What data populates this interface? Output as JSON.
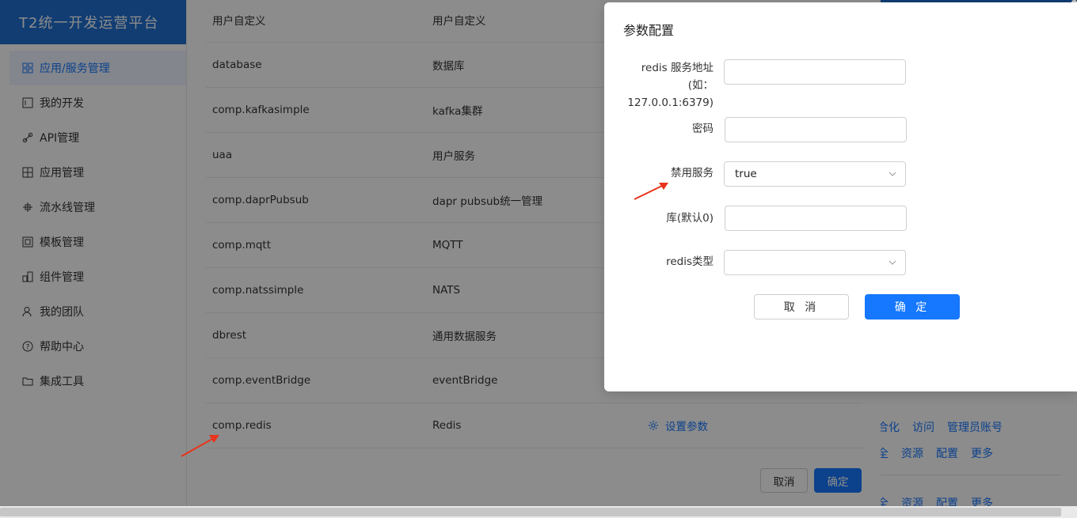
{
  "sidebar": {
    "brand": "T2统一开发运营平台",
    "items": [
      {
        "label": "应用/服务管理",
        "icon": "grid-icon"
      },
      {
        "label": "我的开发",
        "icon": "code-window-icon"
      },
      {
        "label": "API管理",
        "icon": "link-icon"
      },
      {
        "label": "应用管理",
        "icon": "apps-icon"
      },
      {
        "label": "流水线管理",
        "icon": "pipeline-icon"
      },
      {
        "label": "模板管理",
        "icon": "template-icon"
      },
      {
        "label": "组件管理",
        "icon": "component-icon"
      },
      {
        "label": "我的团队",
        "icon": "team-icon"
      },
      {
        "label": "帮助中心",
        "icon": "help-icon"
      },
      {
        "label": "集成工具",
        "icon": "folder-icon"
      }
    ]
  },
  "drawer": {
    "rows": [
      {
        "name": "用户自定义",
        "desc": "用户自定义"
      },
      {
        "name": "database",
        "desc": "数据库"
      },
      {
        "name": "comp.kafkasimple",
        "desc": "kafka集群"
      },
      {
        "name": "uaa",
        "desc": "用户服务"
      },
      {
        "name": "comp.daprPubsub",
        "desc": "dapr pubsub统一管理"
      },
      {
        "name": "comp.mqtt",
        "desc": "MQTT"
      },
      {
        "name": "comp.natssimple",
        "desc": "NATS"
      },
      {
        "name": "dbrest",
        "desc": "通用数据服务"
      },
      {
        "name": "comp.eventBridge",
        "desc": "eventBridge"
      },
      {
        "name": "comp.redis",
        "desc": "Redis",
        "action": "设置参数"
      }
    ],
    "cancel_label": "取消",
    "ok_label": "确定"
  },
  "background": {
    "row1_links": [
      "合化",
      "访问",
      "管理员账号"
    ],
    "row2_links": [
      "全",
      "资源",
      "配置",
      "更多"
    ],
    "row3_links": [
      "全",
      "资源",
      "配置",
      "更多"
    ]
  },
  "modal": {
    "title": "参数配置",
    "fields": {
      "address_label_1": "redis 服务地址",
      "address_label_2": "(如：",
      "address_label_3": "127.0.0.1:6379)",
      "password_label": "密码",
      "disable_label": "禁用服务",
      "disable_value": "true",
      "db_label": "库(默认0)",
      "type_label": "redis类型",
      "type_value": ""
    },
    "cancel_label": "取 消",
    "ok_label": "确 定"
  },
  "colors": {
    "accent": "#1677ff",
    "brand": "#1f6fd1",
    "annotation_arrow": "#e8341c"
  }
}
